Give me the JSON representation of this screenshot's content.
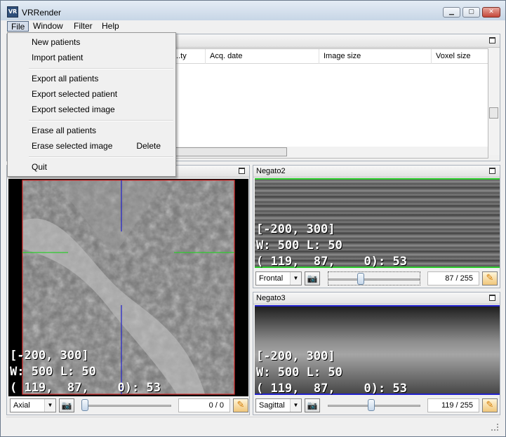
{
  "window": {
    "title": "VRRender",
    "min": "▁",
    "max": "▢",
    "close": "✕"
  },
  "icons": {
    "app": "VR",
    "camera": "📷",
    "pencil": "✎",
    "combo_arrow": "▼"
  },
  "menubar": [
    "File",
    "Window",
    "Filter",
    "Help"
  ],
  "file_menu": {
    "items": [
      {
        "label": "New patients",
        "shortcut": ""
      },
      {
        "label": "Import patient",
        "shortcut": ""
      },
      {
        "label": "Export all patients",
        "shortcut": ""
      },
      {
        "label": "Export selected patient",
        "shortcut": ""
      },
      {
        "label": "Export selected image",
        "shortcut": ""
      },
      {
        "label": "Erase all patients",
        "shortcut": ""
      },
      {
        "label": "Erase selected image",
        "shortcut": "Delete"
      },
      {
        "label": "Quit",
        "shortcut": ""
      }
    ]
  },
  "patients_table": {
    "columns": [
      "...ty",
      "Acq. date",
      "Image size",
      "Voxel size"
    ]
  },
  "views": {
    "axial": {
      "title": "",
      "overlay": [
        "[-200, 300]",
        "W: 500 L: 50",
        "( 119,  87,    0): 53"
      ],
      "orientation": "Axial",
      "slice": "0 / 0",
      "slider_fraction": 0.0
    },
    "negato2": {
      "title": "Negato2",
      "overlay": [
        "[-200, 300]",
        "W: 500 L: 50",
        "( 119,  87,    0): 53"
      ],
      "orientation": "Frontal",
      "slice": "87 / 255",
      "slider_fraction": 0.341
    },
    "negato3": {
      "title": "Negato3",
      "overlay": [
        "[-200, 300]",
        "W: 500 L: 50",
        "( 119,  87,    0): 53"
      ],
      "orientation": "Sagittal",
      "slice": "119 / 255",
      "slider_fraction": 0.467
    }
  },
  "colors": {
    "cursor_h": "#2ecc2e",
    "cursor_v": "#2222cc",
    "frame": "#d33"
  }
}
